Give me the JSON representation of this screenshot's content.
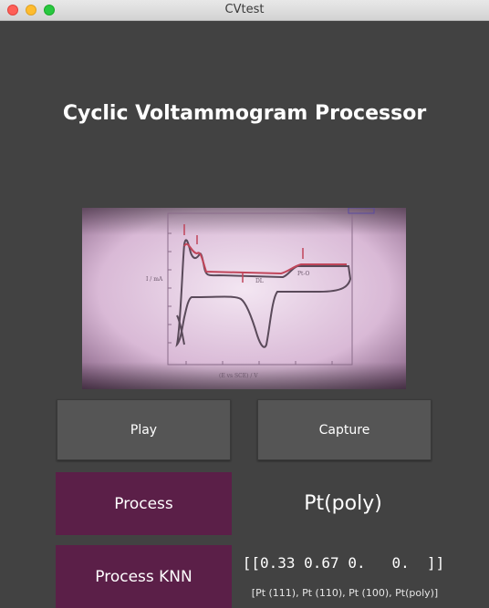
{
  "window": {
    "title": "CVtest"
  },
  "header": {
    "title": "Cyclic Voltammogram Processor"
  },
  "buttons": {
    "play": "Play",
    "capture": "Capture",
    "process": "Process",
    "process_knn": "Process KNN"
  },
  "results": {
    "prediction": "Pt(poly)",
    "probabilities": "[[0.33 0.67 0.   0.  ]]",
    "classes": "[Pt (111), Pt (110), Pt (100), Pt(poly)]"
  },
  "colors": {
    "background": "#424242",
    "button_gray": "#555555",
    "button_purple": "#5b1f48"
  }
}
